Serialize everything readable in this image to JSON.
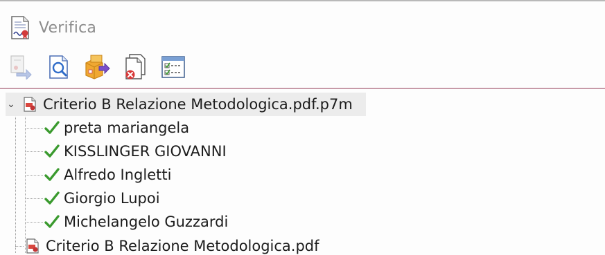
{
  "window": {
    "title": "Verifica",
    "title_icon": "signed-document-icon"
  },
  "toolbar": {
    "buttons": [
      {
        "name": "export-button",
        "icon": "export-arrow-icon",
        "enabled": false
      },
      {
        "name": "view-document-button",
        "icon": "magnifier-document-icon",
        "enabled": true
      },
      {
        "name": "extract-button",
        "icon": "package-extract-icon",
        "enabled": true
      },
      {
        "name": "remove-document-button",
        "icon": "document-remove-icon",
        "enabled": true
      },
      {
        "name": "details-button",
        "icon": "checklist-icon",
        "enabled": true
      }
    ]
  },
  "tree": {
    "root": {
      "label": "Criterio B Relazione Metodologica.pdf.p7m",
      "expanded": true,
      "icon": "pdf-signed-icon"
    },
    "signers": [
      {
        "label": "preta mariangela",
        "status": "valid"
      },
      {
        "label": "KISSLINGER GIOVANNI",
        "status": "valid"
      },
      {
        "label": "Alfredo Ingletti",
        "status": "valid"
      },
      {
        "label": "Giorgio Lupoi",
        "status": "valid"
      },
      {
        "label": "Michelangelo Guzzardi",
        "status": "valid"
      }
    ],
    "child_document": {
      "label": "Criterio B Relazione Metodologica.pdf",
      "icon": "pdf-icon"
    }
  },
  "colors": {
    "check": "#3a9a2e",
    "separator": "#c79aa8",
    "title_text": "#8c8c8c",
    "selected_row": "#ececec"
  }
}
